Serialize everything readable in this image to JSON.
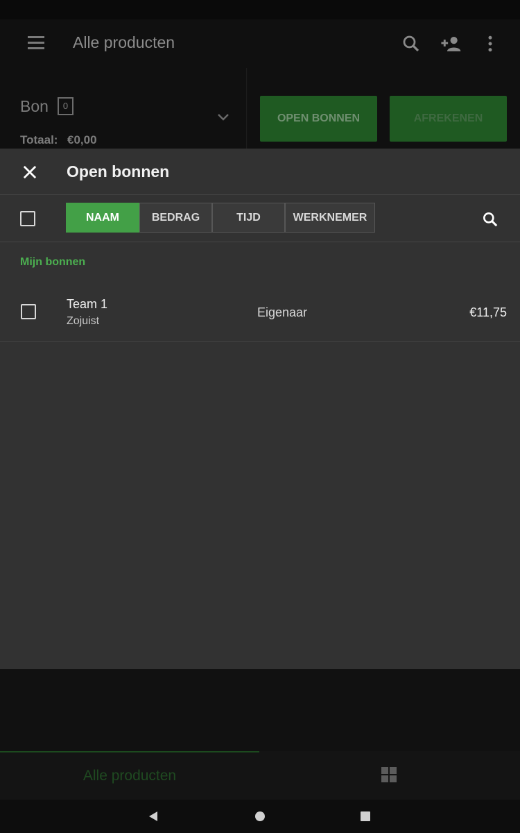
{
  "app_bar": {
    "title": "Alle producten"
  },
  "bon": {
    "title": "Bon",
    "count": "0",
    "total_label": "Totaal:",
    "total_value": "€0,00"
  },
  "actions": {
    "open_tickets": "OPEN BONNEN",
    "checkout": "AFREKENEN"
  },
  "dialog": {
    "title": "Open bonnen",
    "sort_tabs": [
      {
        "label": "NAAM",
        "active": true
      },
      {
        "label": "BEDRAG",
        "active": false
      },
      {
        "label": "TIJD",
        "active": false
      },
      {
        "label": "WERKNEMER",
        "active": false
      }
    ],
    "section_label": "Mijn bonnen",
    "tickets": [
      {
        "name": "Team 1",
        "time": "Zojuist",
        "employee": "Eigenaar",
        "amount": "€11,75",
        "checked": false
      }
    ]
  },
  "bottom_tabs": {
    "all_products": "Alle producten"
  },
  "colors": {
    "accent_green": "#43a047",
    "section_green": "#4caf50",
    "dialog_bg": "#323232"
  },
  "icons": [
    "menu-icon",
    "search-icon",
    "add-customer-icon",
    "more-vert-icon",
    "close-icon",
    "chevron-down-icon",
    "grid-icon",
    "back-icon",
    "home-icon",
    "recents-icon"
  ]
}
